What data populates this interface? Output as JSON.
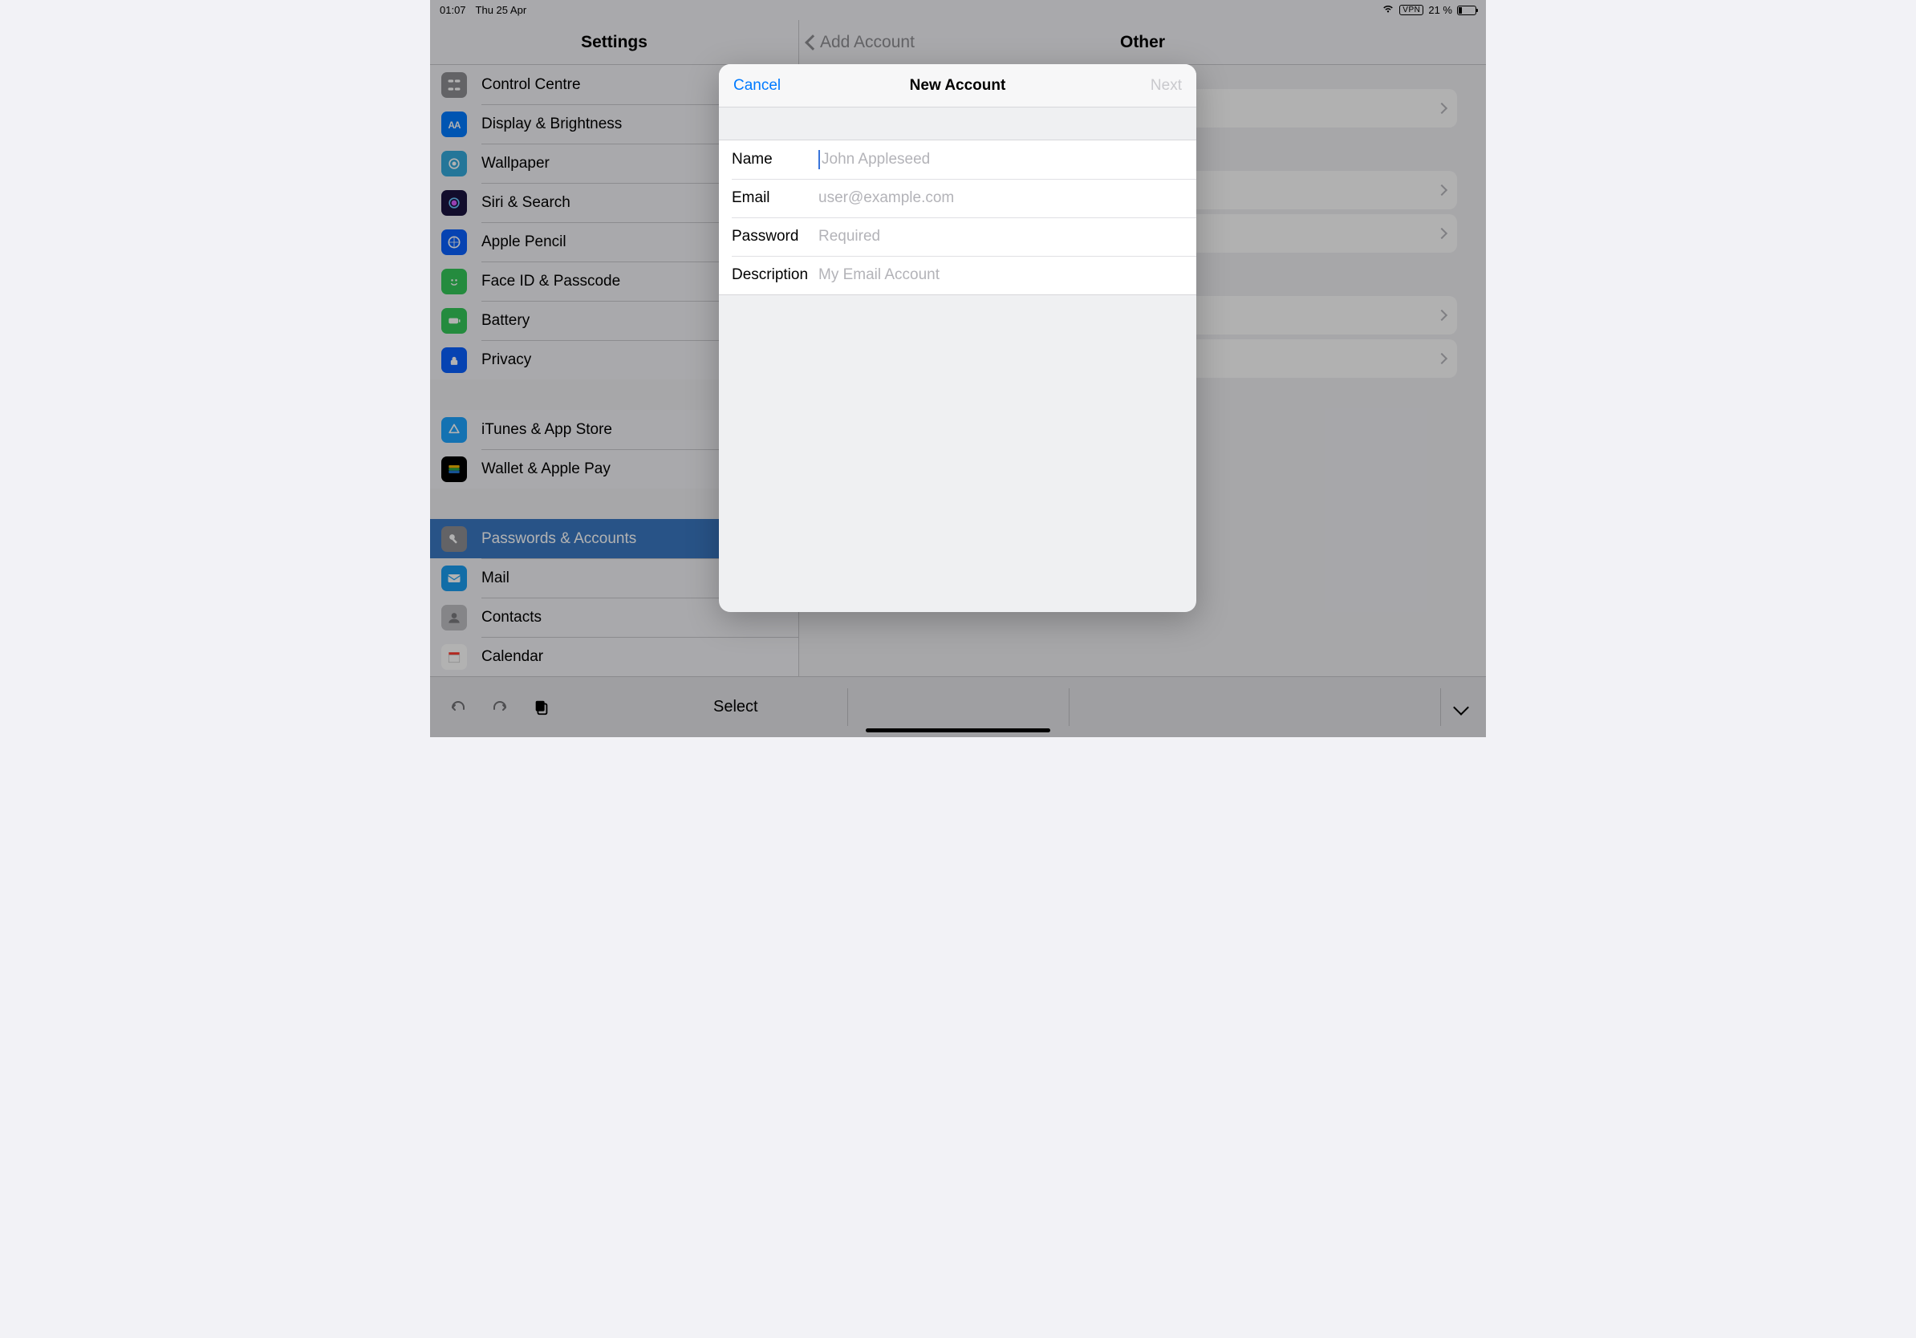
{
  "status_bar": {
    "time": "01:07",
    "date": "Thu 25 Apr",
    "vpn_label": "VPN",
    "battery_text": "21 %"
  },
  "header": {
    "sidebar_title": "Settings",
    "back_label": "Add Account",
    "detail_title": "Other"
  },
  "sidebar": {
    "groups": [
      {
        "items": [
          {
            "key": "control-centre",
            "label": "Control Centre",
            "icon_bg": "#8e8e93",
            "icon": "control"
          },
          {
            "key": "display",
            "label": "Display & Brightness",
            "icon_bg": "#007aff",
            "icon": "display"
          },
          {
            "key": "wallpaper",
            "label": "Wallpaper",
            "icon_bg": "#34aadc",
            "icon": "wallpaper"
          },
          {
            "key": "siri",
            "label": "Siri & Search",
            "icon_bg": "#1b1340",
            "icon": "siri"
          },
          {
            "key": "pencil",
            "label": "Apple Pencil",
            "icon_bg": "#0a60ff",
            "icon": "pencil"
          },
          {
            "key": "faceid",
            "label": "Face ID & Passcode",
            "icon_bg": "#34c759",
            "icon": "faceid"
          },
          {
            "key": "battery",
            "label": "Battery",
            "icon_bg": "#34c759",
            "icon": "battery"
          },
          {
            "key": "privacy",
            "label": "Privacy",
            "icon_bg": "#0a60ff",
            "icon": "privacy"
          }
        ]
      },
      {
        "items": [
          {
            "key": "itunes",
            "label": "iTunes & App Store",
            "icon_bg": "#1da4ff",
            "icon": "appstore"
          },
          {
            "key": "wallet",
            "label": "Wallet & Apple Pay",
            "icon_bg": "#000000",
            "icon": "wallet"
          }
        ]
      },
      {
        "items": [
          {
            "key": "passwords",
            "label": "Passwords & Accounts",
            "icon_bg": "#8e8e93",
            "icon": "key",
            "selected": true
          },
          {
            "key": "mail",
            "label": "Mail",
            "icon_bg": "#1a9cf0",
            "icon": "mail"
          },
          {
            "key": "contacts",
            "label": "Contacts",
            "icon_bg": "#bfbfc3",
            "icon": "contacts"
          },
          {
            "key": "calendar",
            "label": "Calendar",
            "icon_bg": "#ffffff",
            "icon": "calendar"
          }
        ]
      }
    ]
  },
  "toolbar": {
    "select_label": "Select"
  },
  "modal": {
    "title": "New Account",
    "cancel_label": "Cancel",
    "next_label": "Next",
    "fields": {
      "name": {
        "label": "Name",
        "placeholder": "John Appleseed",
        "value": ""
      },
      "email": {
        "label": "Email",
        "placeholder": "user@example.com",
        "value": ""
      },
      "password": {
        "label": "Password",
        "placeholder": "Required",
        "value": ""
      },
      "description": {
        "label": "Description",
        "placeholder": "My Email Account",
        "value": ""
      }
    }
  }
}
